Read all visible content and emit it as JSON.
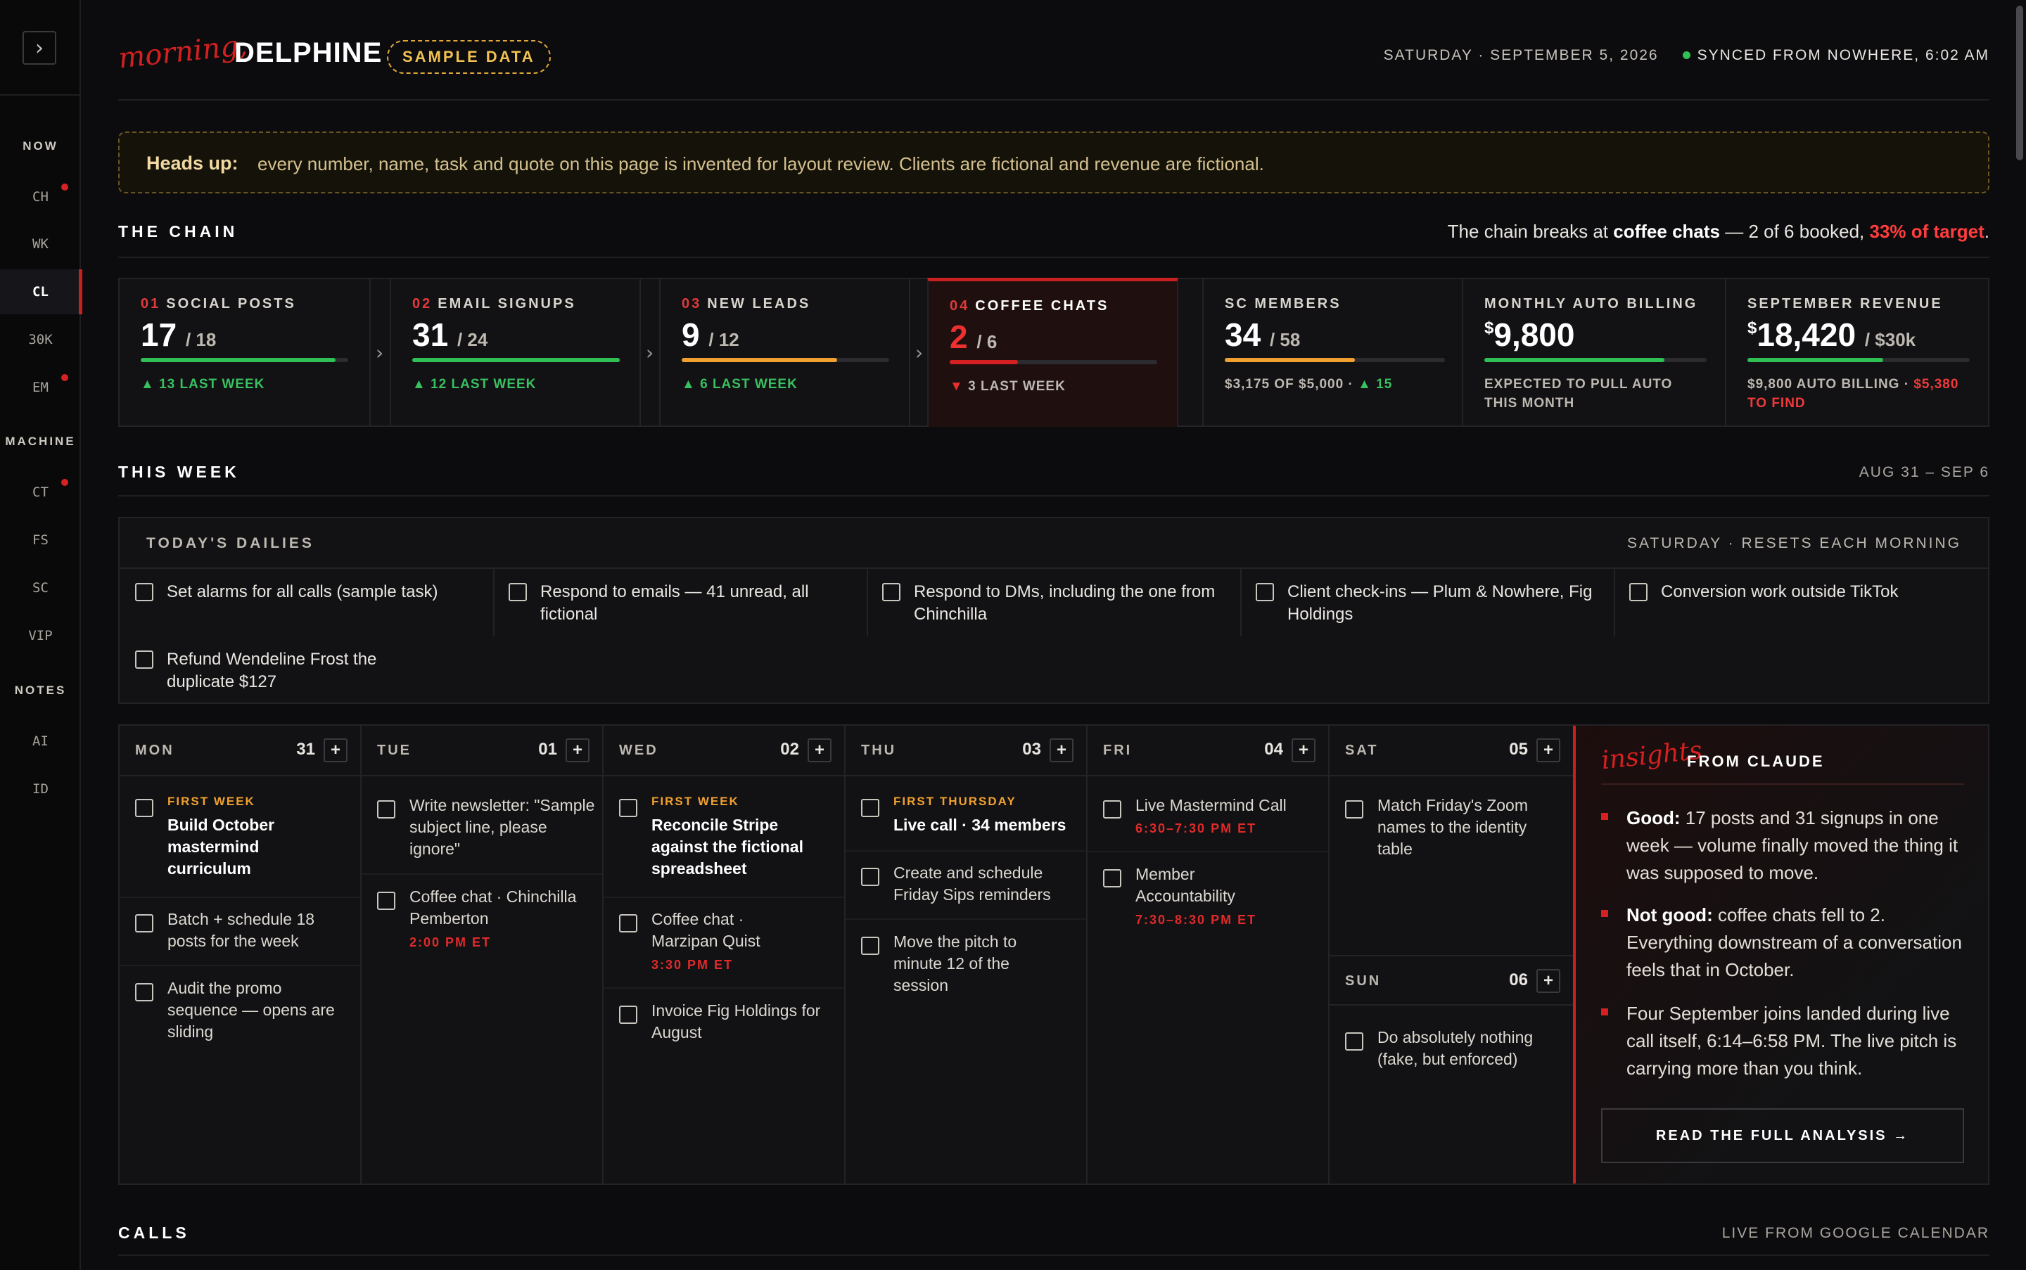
{
  "sidebar": {
    "toggle_glyph": "›",
    "groups": {
      "now": "NOW",
      "machine": "MACHINE",
      "notes": "NOTES"
    },
    "items": {
      "ch": "CH",
      "wk": "WK",
      "cl": "CL",
      "k30": "30K",
      "em": "EM",
      "ct": "CT",
      "fs": "FS",
      "sc": "SC",
      "vip": "VIP",
      "ai": "AI",
      "id": "ID"
    }
  },
  "header": {
    "greeting_script": "morning,",
    "name": "DELPHINE",
    "badge": "SAMPLE DATA",
    "date": "SATURDAY · SEPTEMBER 5, 2026",
    "sync": "SYNCED FROM NOWHERE, 6:02 AM"
  },
  "headsup": {
    "label": "Heads up:",
    "text": "every number, name, task and quote on this page is invented for layout review. Clients are fictional and revenue are fictional."
  },
  "chain": {
    "title": "THE CHAIN",
    "msg_pre": "The chain breaks at",
    "msg_bold": "coffee chats",
    "msg_mid": "— 2 of 6 booked,",
    "msg_red": "33% of target",
    "msg_end": ".",
    "cards": [
      {
        "num": "01",
        "label": "SOCIAL POSTS",
        "value": "17",
        "den": "/ 18",
        "progress": 0.94,
        "color": "#2fbf55",
        "arrow": "▲",
        "sub": "13 LAST WEEK"
      },
      {
        "num": "02",
        "label": "EMAIL SIGNUPS",
        "value": "31",
        "den": "/ 24",
        "progress": 1.0,
        "color": "#2fbf55",
        "arrow": "▲",
        "sub": "12 LAST WEEK"
      },
      {
        "num": "03",
        "label": "NEW LEADS",
        "value": "9",
        "den": "/ 12",
        "progress": 0.75,
        "color": "#f0a030",
        "arrow": "▲",
        "sub": "6 LAST WEEK"
      },
      {
        "num": "04",
        "label": "COFFEE CHATS",
        "value": "2",
        "den": "/ 6",
        "progress": 0.33,
        "color": "#d42020",
        "arrow": "▼",
        "sub": "3 LAST WEEK"
      },
      {
        "label": "SC MEMBERS",
        "value": "34",
        "den": "/ 58",
        "progress": 0.59,
        "color": "#f0a030",
        "sub": "$3,175 OF $5,000 ·",
        "arrow": "▲",
        "sub2": "15"
      },
      {
        "label": "MONTHLY AUTO BILLING",
        "currency": "$",
        "value": "9,800",
        "progress": 0.81,
        "color": "#2fbf55",
        "sub": "EXPECTED TO PULL AUTO",
        "sub_line2": "THIS MONTH"
      },
      {
        "label": "SEPTEMBER REVENUE",
        "currency": "$",
        "value": "18,420",
        "den": "/ $30k",
        "progress": 0.61,
        "color": "#2fbf55",
        "sub": "$9,800 AUTO BILLING ·",
        "sub_red": "$5,380",
        "sub_line2": "TO FIND"
      }
    ]
  },
  "this_week": {
    "title": "THIS WEEK",
    "range": "AUG 31 – SEP 6"
  },
  "dailies": {
    "title": "TODAY'S DAILIES",
    "right": "SATURDAY · RESETS EACH MORNING",
    "items": [
      "Set alarms for all calls (sample task)",
      "Respond to emails — 41 unread, all fictional",
      "Respond to DMs, including the one from Chinchilla",
      "Client check-ins — Plum & Nowhere, Fig Holdings",
      "Conversion work outside TikTok",
      "Refund Wendeline Frost the duplicate $127"
    ]
  },
  "week": {
    "plus": "+",
    "days": [
      {
        "name": "MON",
        "date": "31",
        "tasks": [
          {
            "tag": "FIRST WEEK",
            "text": "Build October mastermind curriculum",
            "bold": true
          },
          {
            "text": "Batch + schedule 18 posts for the week"
          },
          {
            "text": "Audit the promo sequence — opens are sliding"
          }
        ]
      },
      {
        "name": "TUE",
        "date": "01",
        "tasks": [
          {
            "text": "Write newsletter: \"Sample subject line, please ignore\""
          },
          {
            "text": "Coffee chat · Chinchilla Pemberton",
            "time": "2:00 PM ET"
          }
        ]
      },
      {
        "name": "WED",
        "date": "02",
        "tasks": [
          {
            "tag": "FIRST WEEK",
            "text": "Reconcile Stripe against the fictional spreadsheet",
            "bold": true
          },
          {
            "text": "Coffee chat · Marzipan Quist",
            "time": "3:30 PM ET"
          },
          {
            "text": "Invoice Fig Holdings for August"
          }
        ]
      },
      {
        "name": "THU",
        "date": "03",
        "tasks": [
          {
            "tag": "FIRST THURSDAY",
            "text": "Live call · 34 members",
            "bold": true
          },
          {
            "text": "Create and schedule Friday Sips reminders"
          },
          {
            "text": "Move the pitch to minute 12 of the session"
          }
        ]
      },
      {
        "name": "FRI",
        "date": "04",
        "tasks": [
          {
            "text": "Live Mastermind Call",
            "time": "6:30–7:30 PM ET"
          },
          {
            "text": "Member Accountability",
            "time": "7:30–8:30 PM ET"
          }
        ]
      },
      {
        "name": "SAT",
        "date": "05",
        "tasks": [
          {
            "text": "Match Friday's Zoom names to the identity table"
          }
        ]
      },
      {
        "name": "SUN",
        "date": "06",
        "tasks": [
          {
            "text": "Do absolutely nothing (fake, but enforced)"
          }
        ]
      }
    ]
  },
  "insights": {
    "script": "insights",
    "title": "FROM CLAUDE",
    "items": [
      {
        "bold": "Good:",
        "text": " 17 posts and 31 signups in one week — volume finally moved the thing it was supposed to move."
      },
      {
        "bold": "Not good:",
        "text": " coffee chats fell to 2. Everything downstream of a conversation feels that in October."
      },
      {
        "bold": "",
        "text": "Four September joins landed during live call itself, 6:14–6:58 PM. The live pitch is carrying more than you think."
      }
    ],
    "button": "READ THE FULL ANALYSIS →"
  },
  "calls": {
    "title": "CALLS",
    "right": "LIVE FROM GOOGLE CALENDAR"
  }
}
